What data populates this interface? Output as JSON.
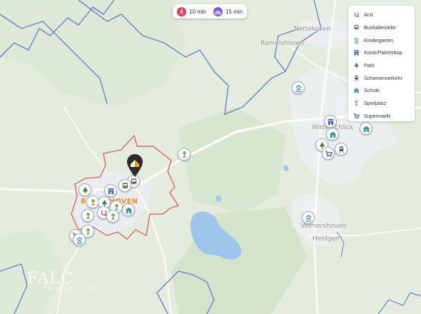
{
  "travel_times": [
    {
      "label": "10 min",
      "mode": "walk",
      "color": "#e83a55"
    },
    {
      "label": "15 min",
      "mode": "bike",
      "color": "#7a5be0"
    }
  ],
  "legend": [
    {
      "label": "Arzt",
      "icon": "doctor-icon",
      "color": "#d6334e"
    },
    {
      "label": "Bushaltestelle",
      "icon": "bus-icon",
      "color": "#4b4b4b"
    },
    {
      "label": "Kindergarten",
      "icon": "kindergarten-icon",
      "color": "#2f8ea0"
    },
    {
      "label": "Kiosk/Paketshop",
      "icon": "kiosk-icon",
      "color": "#3a5dae"
    },
    {
      "label": "Park",
      "icon": "park-icon",
      "color": "#3b7d3b"
    },
    {
      "label": "Schienenverkehr",
      "icon": "train-icon",
      "color": "#4b4b4b"
    },
    {
      "label": "Schule",
      "icon": "school-icon",
      "color": "#2f8ea0"
    },
    {
      "label": "Spielplatz",
      "icon": "playground-icon",
      "color": "#5c9b2e"
    },
    {
      "label": "Supermarkt",
      "icon": "cart-icon",
      "color": "#2e4fa8"
    }
  ],
  "places": {
    "nettekoven": "Nettekoven",
    "ramelshoven": "Ramelshoven",
    "witterschlick": "Witterschlick",
    "volmershoven": "Volmershoven",
    "heidgen": "Heidgen"
  },
  "town": "BUSCHHOVEN",
  "watermark": {
    "brand": "FALC",
    "sub": "IMMOBILIEN"
  },
  "colors": {
    "isochrone": "#d9534f",
    "water": "#9ec6ec",
    "forest": "#c9ddbf",
    "road": "#f6f4ec",
    "boundary": "#6e7fc4",
    "home_marker": "#2b2b2b",
    "home_accent": "#f2a21d"
  }
}
